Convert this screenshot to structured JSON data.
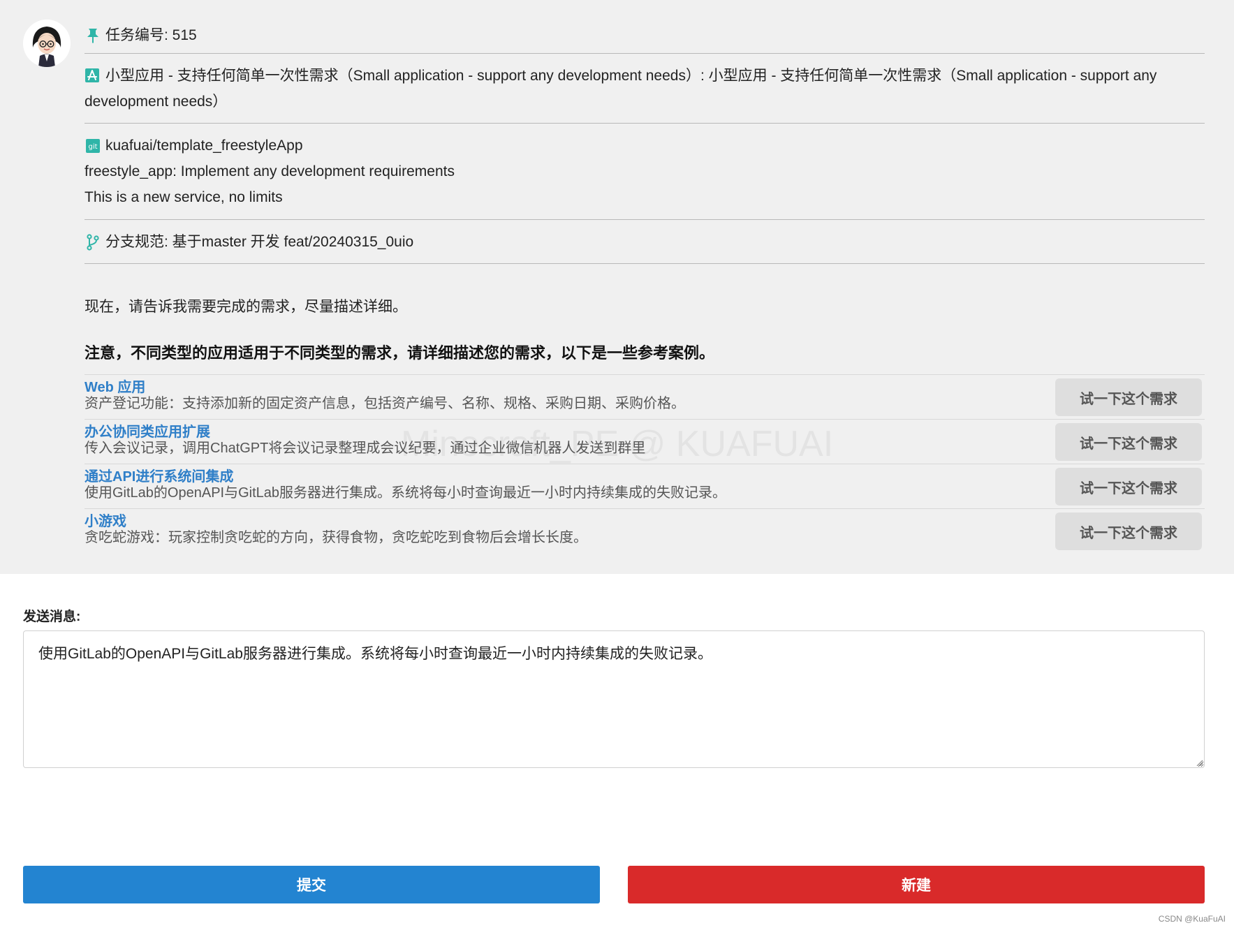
{
  "task": {
    "label": "任务编号: 515"
  },
  "app_type": {
    "text": "小型应用 - 支持任何简单一次性需求（Small application - support any development needs）: 小型应用 - 支持任何简单一次性需求（Small application - support any development needs）"
  },
  "repo": {
    "name": "kuafuai/template_freestyleApp",
    "line1": "freestyle_app: Implement any development requirements",
    "line2": "This is a new service, no limits"
  },
  "branch": {
    "text": "分支规范: 基于master 开发 feat/20240315_0uio"
  },
  "prompt": "现在，请告诉我需要完成的需求，尽量描述详细。",
  "note": "注意，不同类型的应用适用于不同类型的需求，请详细描述您的需求，以下是一些参考案例。",
  "examples": [
    {
      "title": "Web 应用",
      "desc": "资产登记功能：支持添加新的固定资产信息，包括资产编号、名称、规格、采购日期、采购价格。",
      "button": "试一下这个需求"
    },
    {
      "title": "办公协同类应用扩展",
      "desc": "传入会议记录，调用ChatGPT将会议记录整理成会议纪要，通过企业微信机器人发送到群里",
      "button": "试一下这个需求"
    },
    {
      "title": "通过API进行系统间集成",
      "desc": "使用GitLab的OpenAPI与GitLab服务器进行集成。系统将每小时查询最近一小时内持续集成的失败记录。",
      "button": "试一下这个需求"
    },
    {
      "title": "小游戏",
      "desc": "贪吃蛇游戏：玩家控制贪吃蛇的方向，获得食物，贪吃蛇吃到食物后会增长长度。",
      "button": "试一下这个需求"
    }
  ],
  "watermark": "Minecraft_PE @ KUAFUAI",
  "send": {
    "label": "发送消息:",
    "value": "使用GitLab的OpenAPI与GitLab服务器进行集成。系统将每小时查询最近一小时内持续集成的失败记录。"
  },
  "buttons": {
    "submit": "提交",
    "new": "新建"
  },
  "credit": "CSDN @KuaFuAI",
  "colors": {
    "accent": "#2fb5a8",
    "link": "#2f7fc8",
    "submit": "#2384d1",
    "new": "#d92a2a"
  }
}
